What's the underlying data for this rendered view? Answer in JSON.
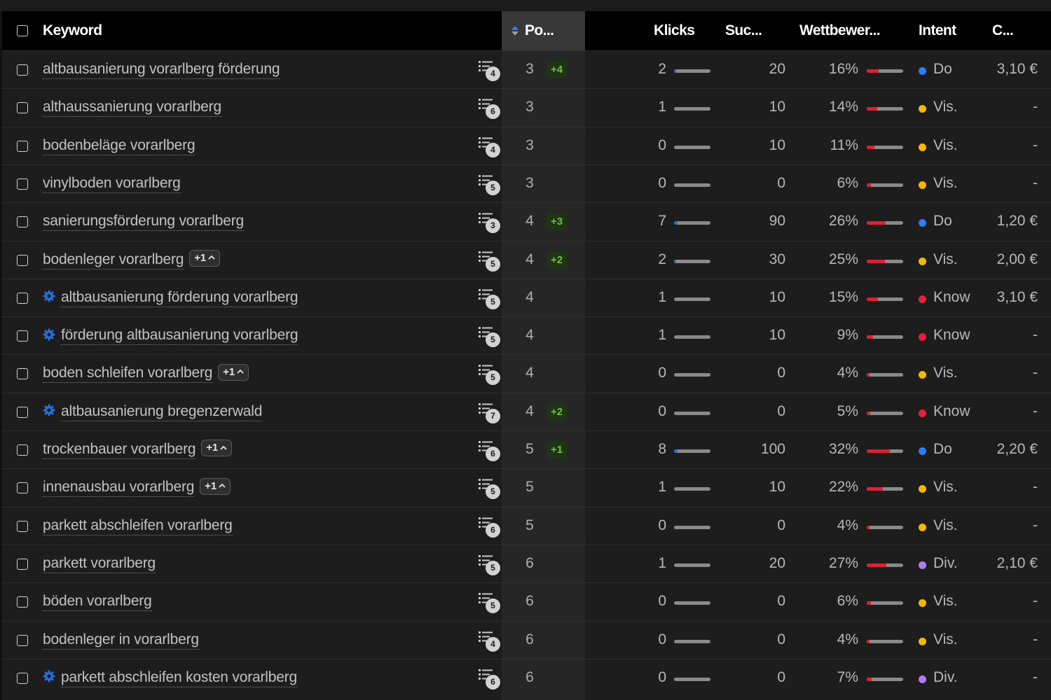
{
  "colors": {
    "accent_blue": "#2a6edc",
    "competition_red": "#e02031",
    "intent_Do": "#2f7bff",
    "intent_Vis.": "#f5b800",
    "intent_Know": "#e8203a",
    "intent_Div.": "#b07af0",
    "pos_change_green": "#6dc23a"
  },
  "header": {
    "keyword": "Keyword",
    "position": "Po...",
    "clicks": "Klicks",
    "search_volume": "Suc...",
    "competition": "Wettbewer...",
    "intent": "Intent",
    "cpc": "C..."
  },
  "rows": [
    {
      "keyword": "altbausanierung vorarlberg förderung",
      "gear": false,
      "plus": "",
      "serp": "4",
      "position": "3",
      "change": "+4",
      "clicks": "2",
      "clicks_ratio": 0.05,
      "volume": "20",
      "competition": "16%",
      "competition_value": 16,
      "intent": "Do",
      "cpc": "3,10 €"
    },
    {
      "keyword": "althaussanierung vorarlberg",
      "gear": false,
      "plus": "",
      "serp": "6",
      "position": "3",
      "change": "",
      "clicks": "1",
      "clicks_ratio": 0.0,
      "volume": "10",
      "competition": "14%",
      "competition_value": 14,
      "intent": "Vis.",
      "cpc": "-"
    },
    {
      "keyword": "bodenbeläge vorarlberg",
      "gear": false,
      "plus": "",
      "serp": "4",
      "position": "3",
      "change": "",
      "clicks": "0",
      "clicks_ratio": 0.0,
      "volume": "10",
      "competition": "11%",
      "competition_value": 11,
      "intent": "Vis.",
      "cpc": "-"
    },
    {
      "keyword": "vinylboden vorarlberg",
      "gear": false,
      "plus": "",
      "serp": "5",
      "position": "3",
      "change": "",
      "clicks": "0",
      "clicks_ratio": 0.0,
      "volume": "0",
      "competition": "6%",
      "competition_value": 6,
      "intent": "Vis.",
      "cpc": "-"
    },
    {
      "keyword": "sanierungsförderung vorarlberg",
      "gear": false,
      "plus": "",
      "serp": "3",
      "position": "4",
      "change": "+3",
      "clicks": "7",
      "clicks_ratio": 0.1,
      "volume": "90",
      "competition": "26%",
      "competition_value": 26,
      "intent": "Do",
      "cpc": "1,20 €"
    },
    {
      "keyword": "bodenleger vorarlberg",
      "gear": false,
      "plus": "+1",
      "serp": "5",
      "position": "4",
      "change": "+2",
      "clicks": "2",
      "clicks_ratio": 0.05,
      "volume": "30",
      "competition": "25%",
      "competition_value": 25,
      "intent": "Vis.",
      "cpc": "2,00 €"
    },
    {
      "keyword": "altbausanierung förderung vorarlberg",
      "gear": true,
      "plus": "",
      "serp": "5",
      "position": "4",
      "change": "",
      "clicks": "1",
      "clicks_ratio": 0.0,
      "volume": "10",
      "competition": "15%",
      "competition_value": 15,
      "intent": "Know",
      "cpc": "3,10 €"
    },
    {
      "keyword": "förderung altbausanierung vorarlberg",
      "gear": true,
      "plus": "",
      "serp": "5",
      "position": "4",
      "change": "",
      "clicks": "1",
      "clicks_ratio": 0.0,
      "volume": "10",
      "competition": "9%",
      "competition_value": 9,
      "intent": "Know",
      "cpc": "-"
    },
    {
      "keyword": "boden schleifen vorarlberg",
      "gear": false,
      "plus": "+1",
      "serp": "5",
      "position": "4",
      "change": "",
      "clicks": "0",
      "clicks_ratio": 0.0,
      "volume": "0",
      "competition": "4%",
      "competition_value": 4,
      "intent": "Vis.",
      "cpc": "-"
    },
    {
      "keyword": "altbausanierung bregenzerwald",
      "gear": true,
      "plus": "",
      "serp": "7",
      "position": "4",
      "change": "+2",
      "clicks": "0",
      "clicks_ratio": 0.0,
      "volume": "0",
      "competition": "5%",
      "competition_value": 5,
      "intent": "Know",
      "cpc": "-"
    },
    {
      "keyword": "trockenbauer vorarlberg",
      "gear": false,
      "plus": "+1",
      "serp": "6",
      "position": "5",
      "change": "+1",
      "clicks": "8",
      "clicks_ratio": 0.1,
      "volume": "100",
      "competition": "32%",
      "competition_value": 32,
      "intent": "Do",
      "cpc": "2,20 €"
    },
    {
      "keyword": "innenausbau vorarlberg",
      "gear": false,
      "plus": "+1",
      "serp": "5",
      "position": "5",
      "change": "",
      "clicks": "1",
      "clicks_ratio": 0.0,
      "volume": "10",
      "competition": "22%",
      "competition_value": 22,
      "intent": "Vis.",
      "cpc": "-"
    },
    {
      "keyword": "parkett abschleifen vorarlberg",
      "gear": false,
      "plus": "",
      "serp": "6",
      "position": "5",
      "change": "",
      "clicks": "0",
      "clicks_ratio": 0.0,
      "volume": "0",
      "competition": "4%",
      "competition_value": 4,
      "intent": "Vis.",
      "cpc": "-"
    },
    {
      "keyword": "parkett vorarlberg",
      "gear": false,
      "plus": "",
      "serp": "5",
      "position": "6",
      "change": "",
      "clicks": "1",
      "clicks_ratio": 0.0,
      "volume": "20",
      "competition": "27%",
      "competition_value": 27,
      "intent": "Div.",
      "cpc": "2,10 €"
    },
    {
      "keyword": "böden vorarlberg",
      "gear": false,
      "plus": "",
      "serp": "5",
      "position": "6",
      "change": "",
      "clicks": "0",
      "clicks_ratio": 0.0,
      "volume": "0",
      "competition": "6%",
      "competition_value": 6,
      "intent": "Vis.",
      "cpc": "-"
    },
    {
      "keyword": "bodenleger in vorarlberg",
      "gear": false,
      "plus": "",
      "serp": "4",
      "position": "6",
      "change": "",
      "clicks": "0",
      "clicks_ratio": 0.0,
      "volume": "0",
      "competition": "4%",
      "competition_value": 4,
      "intent": "Vis.",
      "cpc": "-"
    },
    {
      "keyword": "parkett abschleifen kosten vorarlberg",
      "gear": true,
      "plus": "",
      "serp": "6",
      "position": "6",
      "change": "",
      "clicks": "0",
      "clicks_ratio": 0.0,
      "volume": "0",
      "competition": "7%",
      "competition_value": 7,
      "intent": "Div.",
      "cpc": "-"
    }
  ]
}
